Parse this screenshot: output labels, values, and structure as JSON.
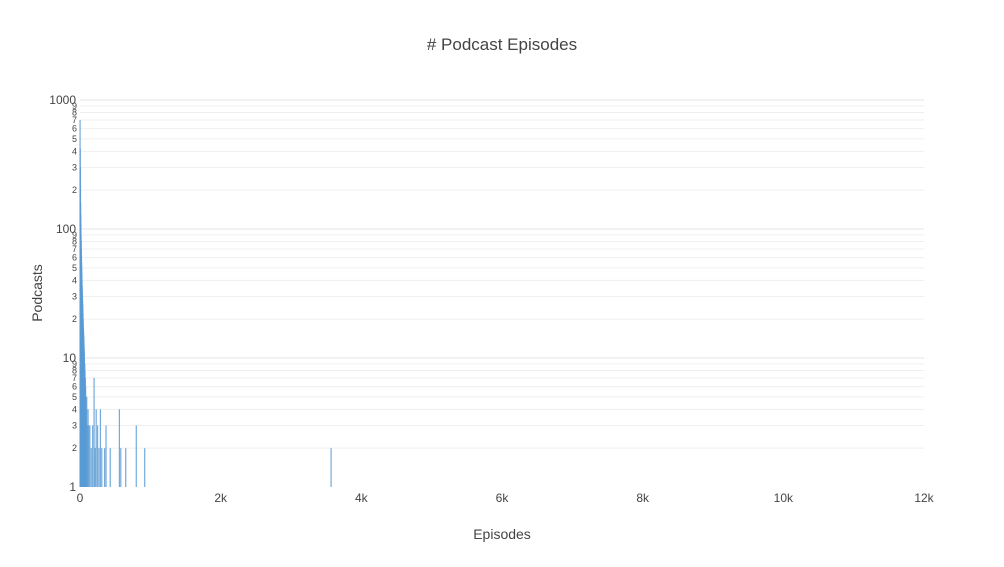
{
  "chart_data": {
    "type": "bar",
    "title": "# Podcast Episodes",
    "xlabel": "Episodes",
    "ylabel": "Podcasts",
    "xlim": [
      0,
      12000
    ],
    "ylim": [
      1,
      1000
    ],
    "y_scale": "log",
    "x_tick_labels": [
      "0",
      "2k",
      "4k",
      "6k",
      "8k",
      "10k",
      "12k"
    ],
    "x_ticks": [
      0,
      2000,
      4000,
      6000,
      8000,
      10000,
      12000
    ],
    "y_major_ticks": [
      1,
      10,
      100,
      1000
    ],
    "y_major_labels": [
      "1",
      "10",
      "100",
      "1000"
    ],
    "y_minor_digits": [
      "2",
      "3",
      "4",
      "5",
      "6",
      "7",
      "8",
      "9"
    ],
    "grid": true,
    "bar_color": "#5b9bd5",
    "bars": [
      {
        "x": 1,
        "y": 700
      },
      {
        "x": 3,
        "y": 420
      },
      {
        "x": 5,
        "y": 300
      },
      {
        "x": 7,
        "y": 220
      },
      {
        "x": 9,
        "y": 160
      },
      {
        "x": 11,
        "y": 130
      },
      {
        "x": 13,
        "y": 110
      },
      {
        "x": 15,
        "y": 90
      },
      {
        "x": 17,
        "y": 80
      },
      {
        "x": 19,
        "y": 70
      },
      {
        "x": 21,
        "y": 62
      },
      {
        "x": 23,
        "y": 55
      },
      {
        "x": 25,
        "y": 50
      },
      {
        "x": 27,
        "y": 45
      },
      {
        "x": 29,
        "y": 40
      },
      {
        "x": 31,
        "y": 36
      },
      {
        "x": 33,
        "y": 33
      },
      {
        "x": 35,
        "y": 30
      },
      {
        "x": 37,
        "y": 28
      },
      {
        "x": 39,
        "y": 26
      },
      {
        "x": 41,
        "y": 24
      },
      {
        "x": 43,
        "y": 22
      },
      {
        "x": 45,
        "y": 20
      },
      {
        "x": 47,
        "y": 18
      },
      {
        "x": 49,
        "y": 17
      },
      {
        "x": 51,
        "y": 16
      },
      {
        "x": 53,
        "y": 15
      },
      {
        "x": 55,
        "y": 14
      },
      {
        "x": 57,
        "y": 13
      },
      {
        "x": 59,
        "y": 12
      },
      {
        "x": 61,
        "y": 11
      },
      {
        "x": 63,
        "y": 10
      },
      {
        "x": 65,
        "y": 9
      },
      {
        "x": 67,
        "y": 9
      },
      {
        "x": 69,
        "y": 8
      },
      {
        "x": 71,
        "y": 8
      },
      {
        "x": 73,
        "y": 7
      },
      {
        "x": 75,
        "y": 7
      },
      {
        "x": 77,
        "y": 6
      },
      {
        "x": 80,
        "y": 6
      },
      {
        "x": 84,
        "y": 5
      },
      {
        "x": 90,
        "y": 4
      },
      {
        "x": 96,
        "y": 5
      },
      {
        "x": 105,
        "y": 3
      },
      {
        "x": 115,
        "y": 4
      },
      {
        "x": 125,
        "y": 3
      },
      {
        "x": 140,
        "y": 3
      },
      {
        "x": 160,
        "y": 2
      },
      {
        "x": 180,
        "y": 3
      },
      {
        "x": 200,
        "y": 7
      },
      {
        "x": 215,
        "y": 2
      },
      {
        "x": 230,
        "y": 4
      },
      {
        "x": 250,
        "y": 3
      },
      {
        "x": 270,
        "y": 2
      },
      {
        "x": 290,
        "y": 4
      },
      {
        "x": 310,
        "y": 2
      },
      {
        "x": 350,
        "y": 2
      },
      {
        "x": 370,
        "y": 3
      },
      {
        "x": 430,
        "y": 2
      },
      {
        "x": 560,
        "y": 4
      },
      {
        "x": 580,
        "y": 2
      },
      {
        "x": 650,
        "y": 2
      },
      {
        "x": 800,
        "y": 3
      },
      {
        "x": 920,
        "y": 2
      },
      {
        "x": 3570,
        "y": 2
      }
    ]
  }
}
